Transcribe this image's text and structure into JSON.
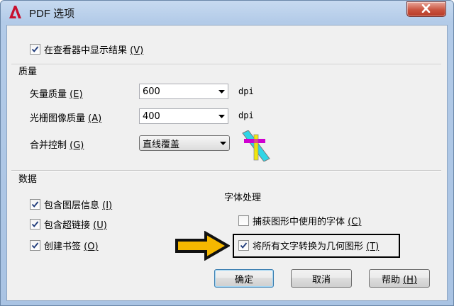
{
  "window": {
    "title": "PDF 选项"
  },
  "general": {
    "show_results_label": "在查看器中显示结果",
    "show_results_accel": "(V)",
    "show_results_checked": true
  },
  "quality": {
    "heading": "质量",
    "vector_label": "矢量质量",
    "vector_accel": "(E)",
    "vector_value": "600",
    "raster_label": "光栅图像质量",
    "raster_accel": "(A)",
    "raster_value": "400",
    "unit": "dpi",
    "merge_label": "合并控制",
    "merge_accel": "(G)",
    "merge_value": "直线覆盖"
  },
  "data_section": {
    "heading": "数据",
    "items": [
      {
        "label": "包含图层信息",
        "accel": "(I)",
        "checked": true
      },
      {
        "label": "包含超链接",
        "accel": "(U)",
        "checked": true
      },
      {
        "label": "创建书签",
        "accel": "(O)",
        "checked": true
      }
    ]
  },
  "font_section": {
    "heading": "字体处理",
    "capture_label": "捕获图形中使用的字体",
    "capture_accel": "(C)",
    "capture_checked": false,
    "convert_label": "将所有文字转换为几何图形",
    "convert_accel": "(T)",
    "convert_checked": true
  },
  "buttons": {
    "ok": "确定",
    "cancel": "取消",
    "help": "帮助",
    "help_accel": "(H)"
  },
  "colors": {
    "arrow_fill": "#f5b800",
    "highlight_border": "#000000",
    "preview_magenta": "#d000d0",
    "preview_cyan": "#2fd5e6",
    "preview_yellow": "#f2e600"
  }
}
